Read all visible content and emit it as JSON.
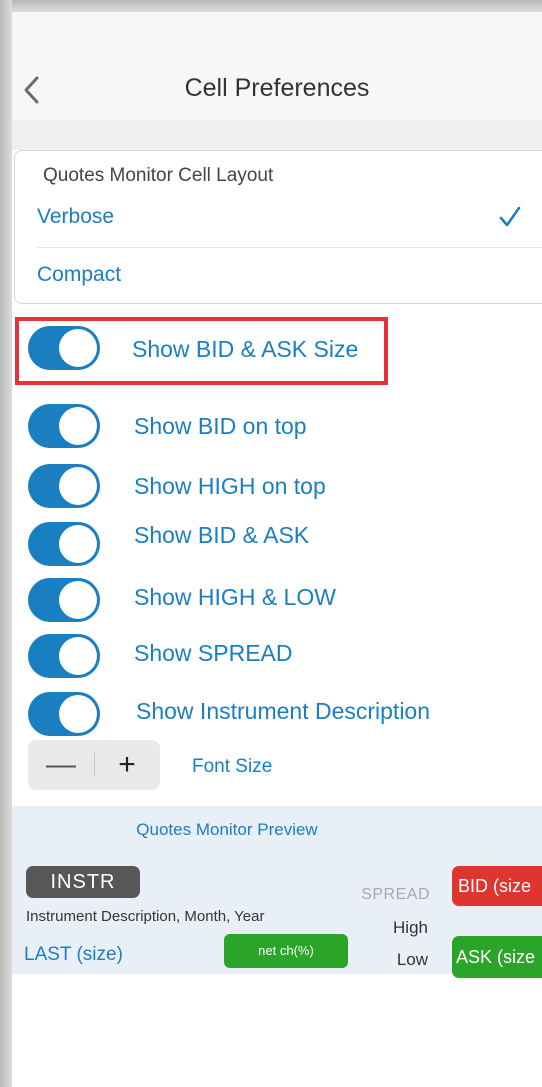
{
  "nav": {
    "title": "Cell Preferences",
    "back_icon": "chevron-left-icon"
  },
  "layout_section": {
    "header": "Quotes Monitor Cell Layout",
    "options": [
      {
        "label": "Verbose",
        "selected": true
      },
      {
        "label": "Compact",
        "selected": false
      }
    ],
    "check_icon": "checkmark-icon"
  },
  "toggles": [
    {
      "label": "Show BID & ASK Size",
      "on": true,
      "highlighted": true
    },
    {
      "label": "Show BID on top",
      "on": true
    },
    {
      "label": "Show HIGH on top",
      "on": true
    },
    {
      "label": "Show BID & ASK",
      "on": true
    },
    {
      "label": "Show HIGH & LOW",
      "on": true
    },
    {
      "label": "Show SPREAD",
      "on": true
    },
    {
      "label": "Show Instrument Description",
      "on": true
    }
  ],
  "font_size": {
    "minus": "—",
    "plus": "+",
    "label": "Font Size"
  },
  "preview": {
    "title": "Quotes Monitor Preview",
    "instr": "INSTR",
    "description": "Instrument Description, Month, Year",
    "last": "LAST (size)",
    "net_change": "net ch(%)",
    "spread": "SPREAD",
    "high": "High",
    "low": "Low",
    "bid": "BID (size",
    "ask": "ASK (size"
  },
  "colors": {
    "accent": "#1a7fc1",
    "highlight": "#e3333d",
    "bid": "#e0342f",
    "ask": "#2aa52a",
    "instr_badge": "#575757"
  }
}
